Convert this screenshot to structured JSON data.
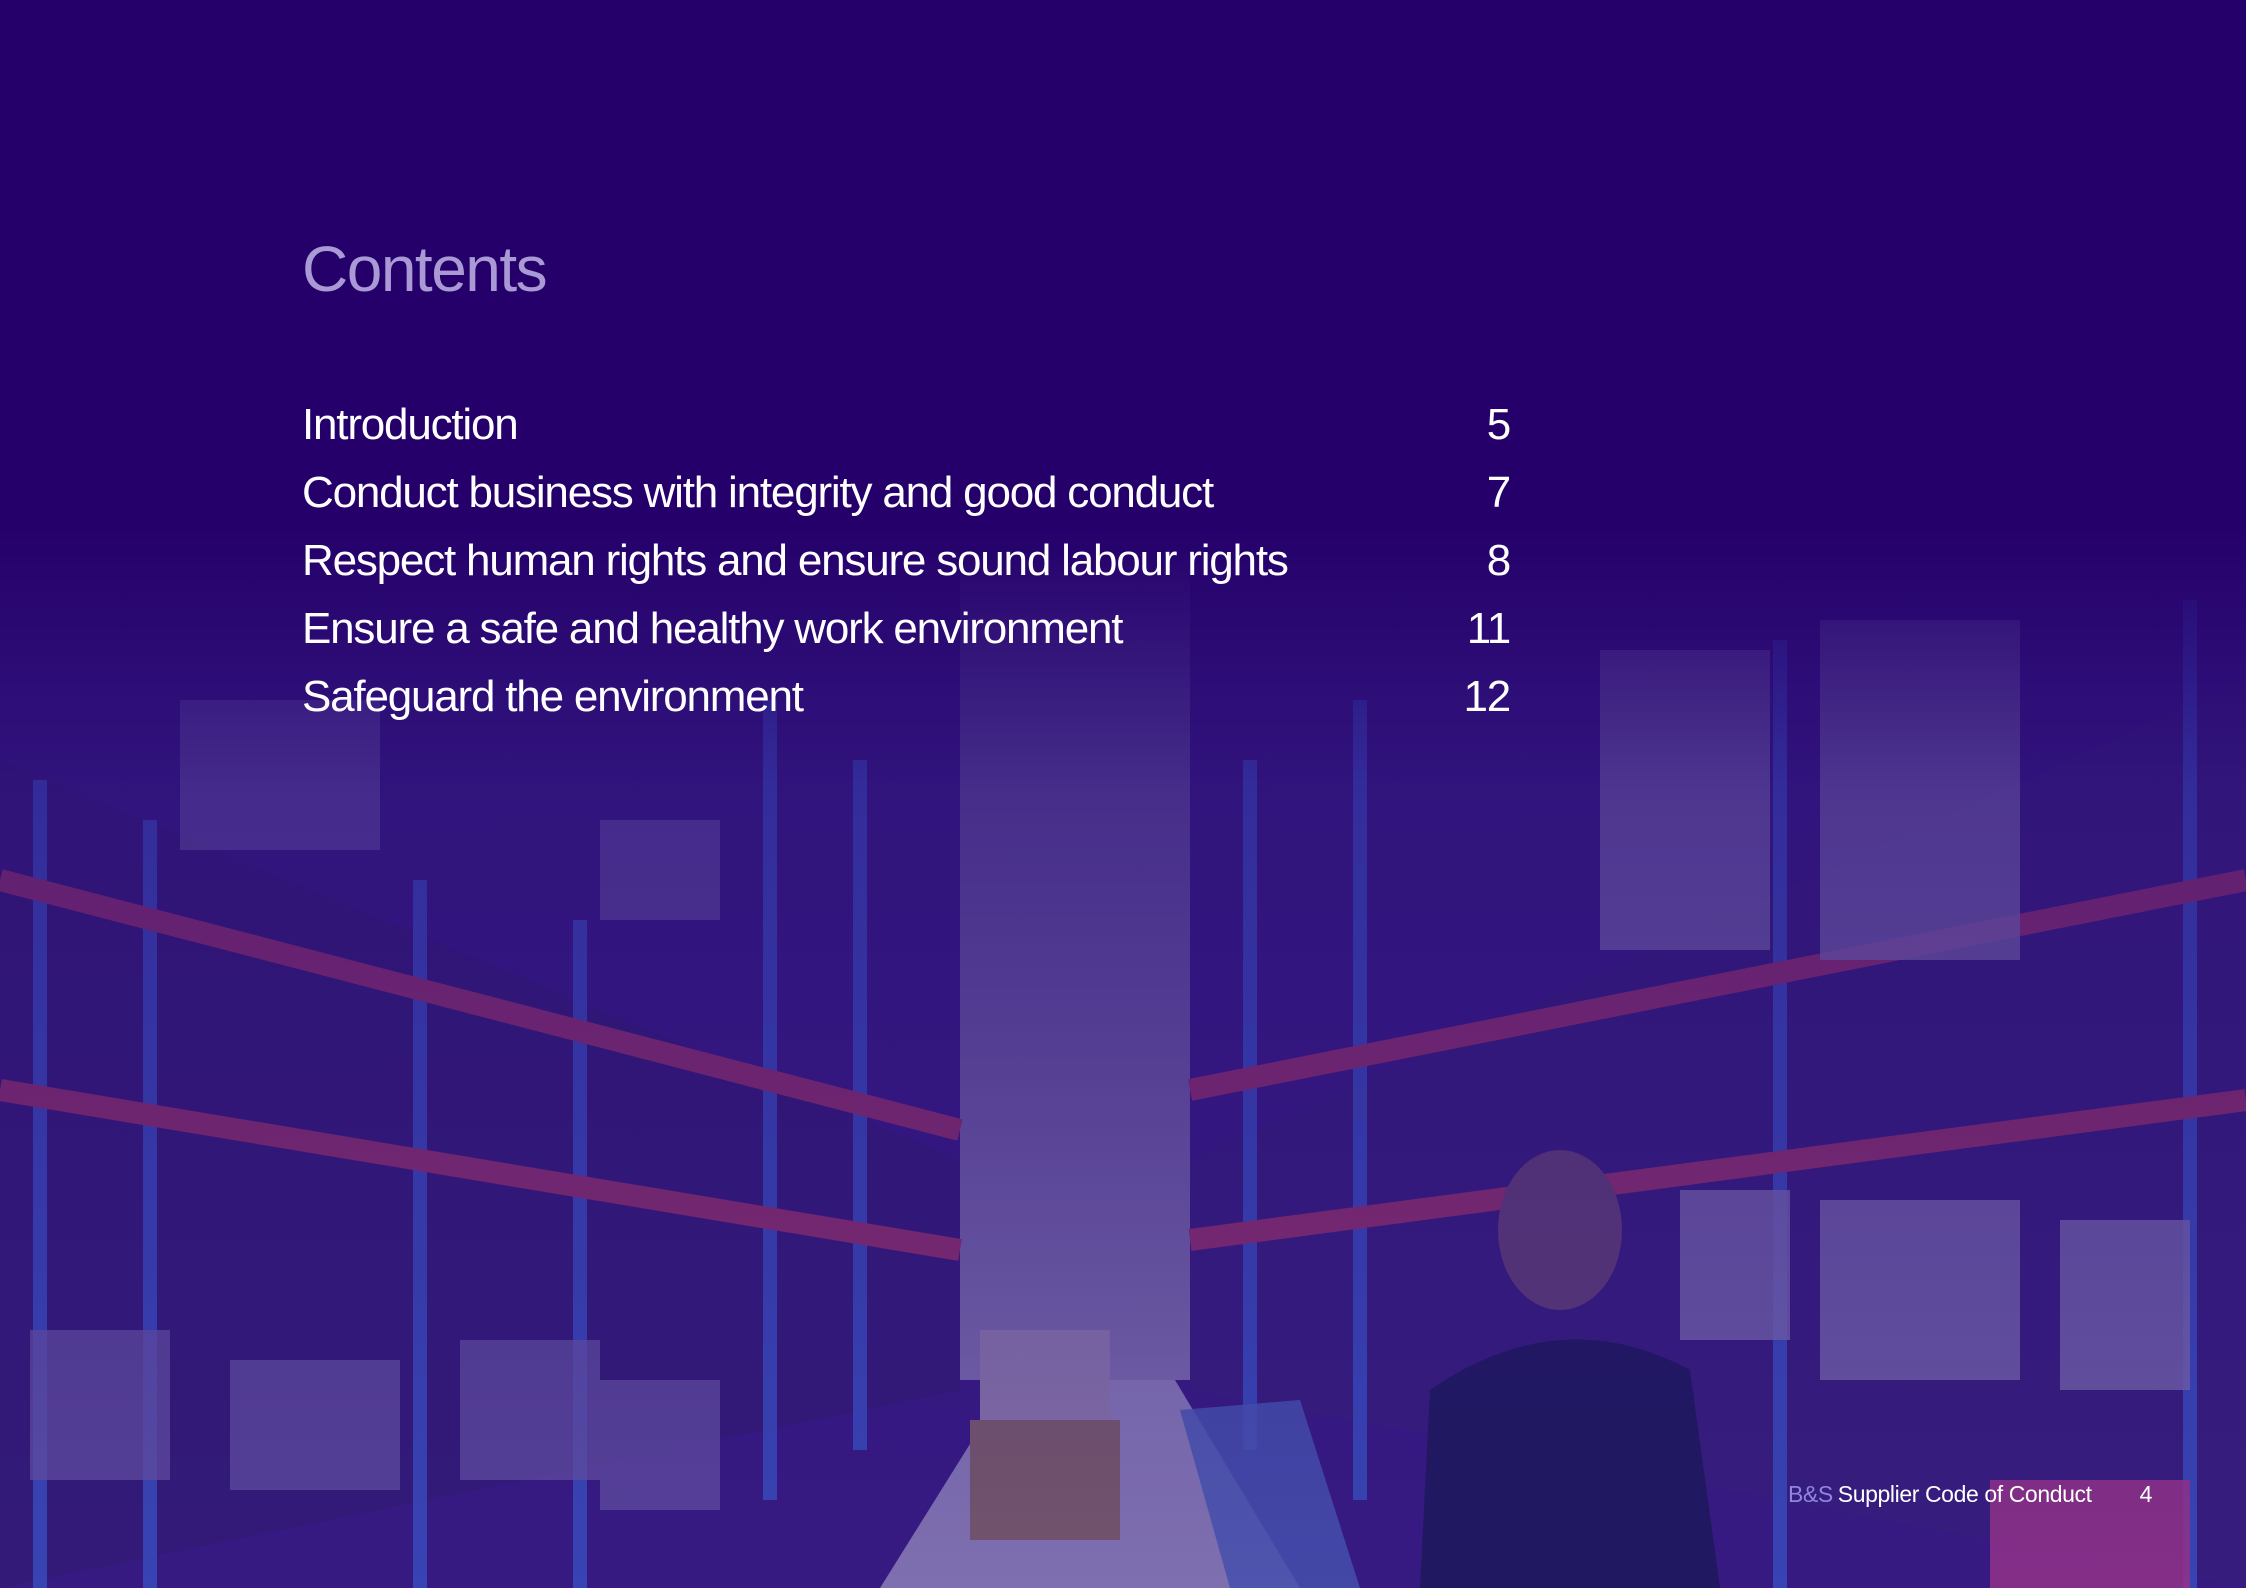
{
  "title": "Contents",
  "toc": [
    {
      "label": "Introduction",
      "page": "5"
    },
    {
      "label": "Conduct business with integrity and good conduct",
      "page": "7"
    },
    {
      "label": "Respect human rights and ensure sound labour rights",
      "page": "8"
    },
    {
      "label": "Ensure a safe and healthy work environment",
      "page": "11"
    },
    {
      "label": "Safeguard the environment",
      "page": "12"
    }
  ],
  "footer": {
    "brand": "B&S",
    "document_title": "Supplier Code of Conduct",
    "page_number": "4"
  },
  "colors": {
    "background": "#25006a",
    "title": "#a99ad6",
    "text": "#ffffff",
    "brand": "#8d86e0"
  }
}
